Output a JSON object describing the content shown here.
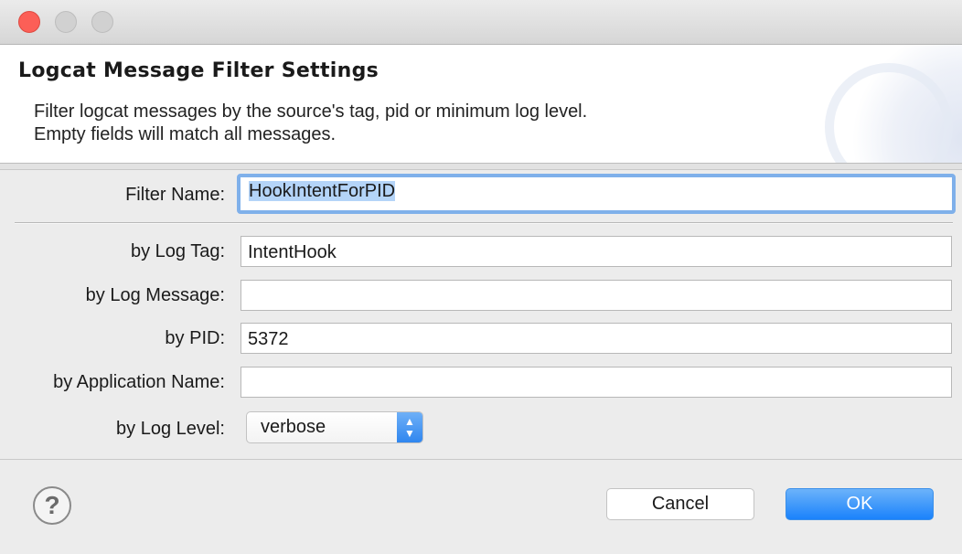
{
  "dialog": {
    "title": "Logcat Message Filter Settings",
    "description_line1": "Filter logcat messages by the source's tag, pid or minimum log level.",
    "description_line2": "Empty fields will match all messages."
  },
  "form": {
    "filter_name": {
      "label": "Filter Name:",
      "value": "HookIntentForPID"
    },
    "log_tag": {
      "label": "by Log Tag:",
      "value": "IntentHook"
    },
    "log_message": {
      "label": "by Log Message:",
      "value": ""
    },
    "pid": {
      "label": "by PID:",
      "value": "5372"
    },
    "app_name": {
      "label": "by Application Name:",
      "value": ""
    },
    "log_level": {
      "label": "by Log Level:",
      "value": "verbose"
    }
  },
  "buttons": {
    "help_glyph": "?",
    "cancel": "Cancel",
    "ok": "OK"
  },
  "icons": {
    "help": "help-icon",
    "stepper": "chevron-up-down-icon"
  },
  "colors": {
    "accent": "#1a82fb",
    "focus_ring": "#7fb0ea",
    "close_light": "#fc5f57"
  }
}
